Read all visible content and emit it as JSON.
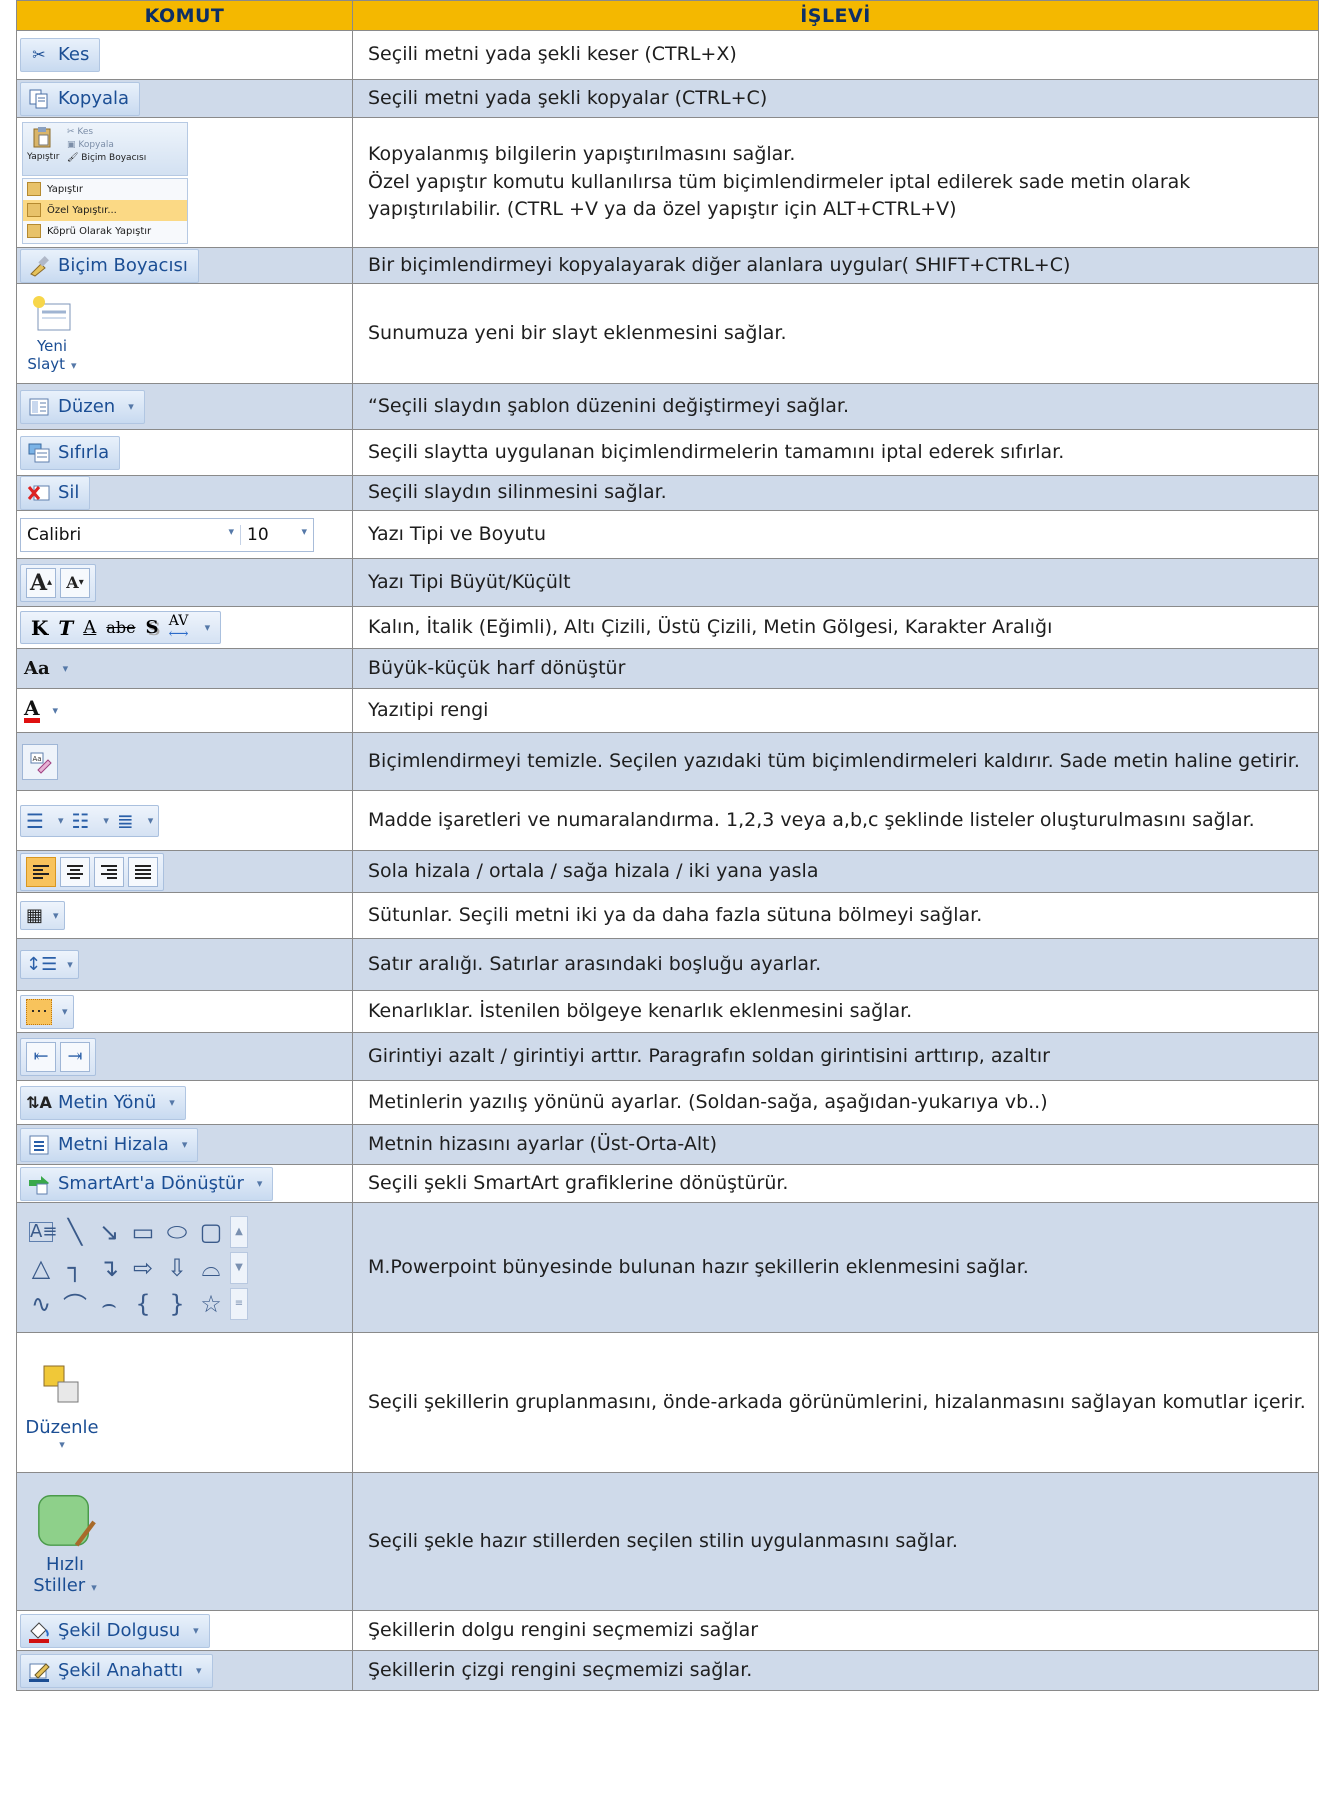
{
  "header": {
    "col1": "KOMUT",
    "col2": "İŞLEVİ"
  },
  "rows": [
    {
      "cmd": "Kes",
      "desc": "Seçili metni yada şekli keser  (CTRL+X)"
    },
    {
      "cmd": "Kopyala",
      "desc": "Seçili metni yada şekli kopyalar (CTRL+C)"
    },
    {
      "cmd": "Yapıştır",
      "desc": "Kopyalanmış bilgilerin yapıştırılmasını sağlar.\nÖzel yapıştır komutu kullanılırsa tüm biçimlendirmeler iptal edilerek sade metin olarak yapıştırılabilir. (CTRL +V  ya da özel yapıştır için ALT+CTRL+V)",
      "menu": {
        "kes": "Kes",
        "kopyala": "Kopyala",
        "bicim": "Biçim Boyacısı",
        "yapistir": "Yapıştır",
        "ozel": "Özel Yapıştır...",
        "kopru": "Köprü Olarak Yapıştır"
      }
    },
    {
      "cmd": "Biçim Boyacısı",
      "desc": "Bir biçimlendirmeyi kopyalayarak diğer alanlara uygular( SHIFT+CTRL+C)"
    },
    {
      "cmd_line1": "Yeni",
      "cmd_line2": "Slayt",
      "desc": "Sunumuza yeni bir slayt eklenmesini sağlar."
    },
    {
      "cmd": "Düzen",
      "desc": "“Seçili slaydın şablon düzenini değiştirmeyi sağlar."
    },
    {
      "cmd": "Sıfırla",
      "desc": "Seçili slaytta uygulanan biçimlendirmelerin tamamını iptal ederek sıfırlar."
    },
    {
      "cmd": "Sil",
      "desc": "Seçili slaydın silinmesini sağlar."
    },
    {
      "font": "Calibri",
      "size": "10",
      "desc": "Yazı Tipi ve Boyutu"
    },
    {
      "desc": "Yazı Tipi Büyüt/Küçült"
    },
    {
      "glyphs": [
        "K",
        "T",
        "A",
        "abe",
        "S",
        "AV"
      ],
      "desc": "Kalın, İtalik (Eğimli), Altı Çizili, Üstü Çizili, Metin Gölgesi, Karakter Aralığı"
    },
    {
      "glyph": "Aa",
      "desc": "Büyük-küçük harf dönüştür"
    },
    {
      "glyph": "A",
      "desc": "Yazıtipi rengi"
    },
    {
      "desc": "Biçimlendirmeyi temizle. Seçilen yazıdaki tüm biçimlendirmeleri kaldırır. Sade metin haline getirir."
    },
    {
      "desc": "Madde işaretleri ve numaralandırma. 1,2,3 veya a,b,c şeklinde listeler oluşturulmasını sağlar."
    },
    {
      "desc": "Sola hizala / ortala / sağa hizala / iki yana yasla"
    },
    {
      "desc": "Sütunlar. Seçili metni iki ya da daha fazla sütuna bölmeyi sağlar."
    },
    {
      "desc": "Satır aralığı. Satırlar arasındaki boşluğu ayarlar."
    },
    {
      "desc": "Kenarlıklar. İstenilen bölgeye kenarlık eklenmesini sağlar."
    },
    {
      "desc": "Girintiyi azalt / girintiyi arttır. Paragrafın soldan girintisini arttırıp, azaltır"
    },
    {
      "cmd": "Metin Yönü",
      "desc": "Metinlerin yazılış yönünü ayarlar. (Soldan-sağa, aşağıdan-yukarıya vb..)"
    },
    {
      "cmd": "Metni Hizala",
      "desc": "Metnin hizasını ayarlar (Üst-Orta-Alt)"
    },
    {
      "cmd": "SmartArt'a Dönüştür",
      "desc": "Seçili şekli SmartArt grafiklerine dönüştürür."
    },
    {
      "desc": "M.Powerpoint bünyesinde bulunan hazır şekillerin eklenmesini sağlar."
    },
    {
      "cmd": "Düzenle",
      "desc": "Seçili şekillerin gruplanmasını, önde-arkada görünümlerini, hizalanmasını sağlayan komutlar içerir."
    },
    {
      "cmd_line1": "Hızlı",
      "cmd_line2": "Stiller",
      "desc": "Seçili şekle hazır stillerden seçilen stilin uygulanmasını sağlar."
    },
    {
      "cmd": "Şekil Dolgusu",
      "desc": "Şekillerin dolgu rengini seçmemizi sağlar"
    },
    {
      "cmd": "Şekil Anahattı",
      "desc": "Şekillerin çizgi rengini seçmemizi sağlar."
    }
  ]
}
